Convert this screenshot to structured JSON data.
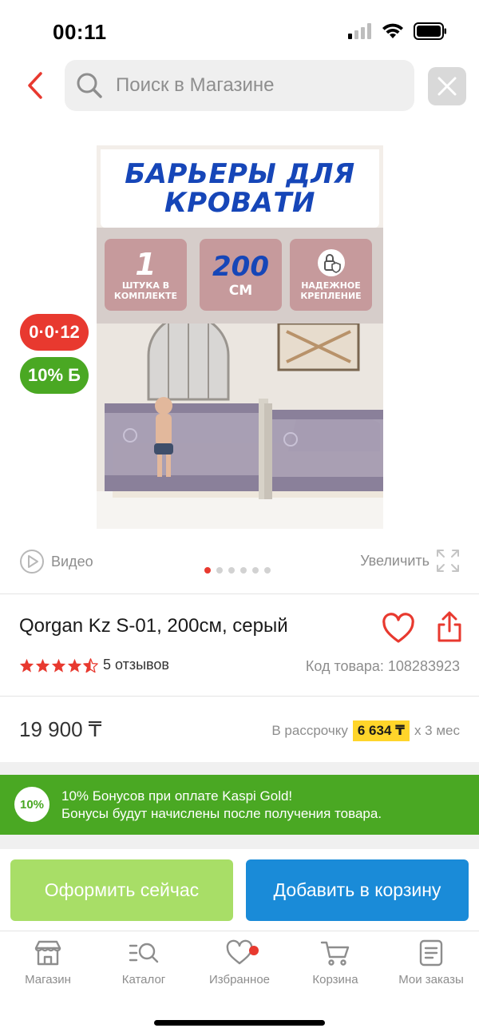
{
  "status": {
    "time": "00:11"
  },
  "search": {
    "placeholder": "Поиск в Магазине"
  },
  "image": {
    "title": "БАРЬЕРЫ ДЛЯ КРОВАТИ",
    "features": [
      {
        "big": "1",
        "small": "ШТУКА В КОМПЛЕКТЕ"
      },
      {
        "big": "200",
        "small": "СМ"
      },
      {
        "big": "",
        "small": "НАДЕЖНОЕ КРЕПЛЕНИЕ"
      }
    ]
  },
  "badges": {
    "age": "0·0·12",
    "bonus": "10% Б"
  },
  "media": {
    "video_label": "Видео",
    "zoom_label": "Увеличить",
    "slides_total": 6,
    "slide_active": 1
  },
  "product": {
    "title": "Qorgan Kz S-01, 200см, серый",
    "rating": 4.5,
    "reviews": "5 отзывов",
    "code": "Код товара: 108283923",
    "price": "19 900 ₸",
    "installment_prefix": "В рассрочку",
    "installment_amount": "6 634 ₸",
    "installment_suffix": "х 3 мес"
  },
  "bonus_banner": {
    "badge": "10%",
    "line1": "10% Бонусов при оплате Kaspi Gold!",
    "line2": "Бонусы будут начислены после получения товара."
  },
  "actions": {
    "order_label": "Оформить сейчас",
    "cart_label": "Добавить в корзину"
  },
  "tabs": [
    {
      "label": "Магазин",
      "icon": "store-icon"
    },
    {
      "label": "Каталог",
      "icon": "catalog-search-icon"
    },
    {
      "label": "Избранное",
      "icon": "heart-icon"
    },
    {
      "label": "Корзина",
      "icon": "cart-icon"
    },
    {
      "label": "Мои заказы",
      "icon": "orders-icon"
    }
  ],
  "colors": {
    "accent_red": "#e8392f",
    "kaspi_green": "#4aa823",
    "order_green": "#a8de67",
    "cart_blue": "#1a8bd8",
    "installment_yellow": "#ffd52a"
  }
}
